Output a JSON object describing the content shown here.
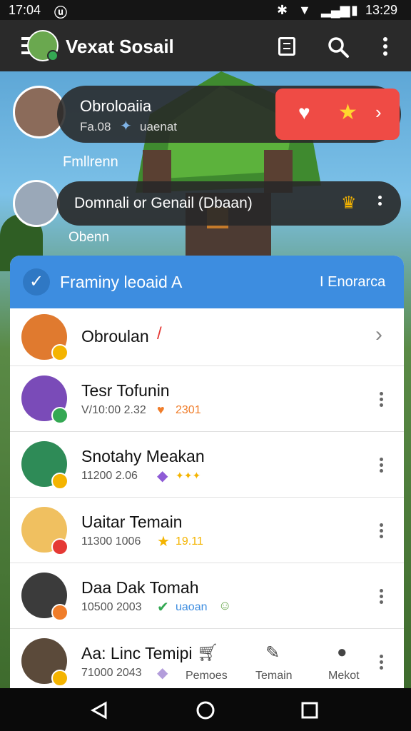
{
  "status_bar": {
    "time_left": "17:04",
    "time_right": "13:29"
  },
  "app_bar": {
    "title": "Vexat Sosail"
  },
  "floating": {
    "top_small": "",
    "bubble1": {
      "title": "Obroloaiia",
      "sub_a": "Fa.08",
      "sub_b": "uaenat"
    },
    "under1": "Fmllrenn",
    "bubble2": {
      "text": "Domnali or Genail (Dbaan)"
    },
    "under2": "Obenn"
  },
  "card": {
    "header_title": "Framiny leoaid A",
    "header_action": "I Enorarca",
    "rows": [
      {
        "name": "Obroulan",
        "sub_a": "",
        "sub_b": "",
        "avatar_color": "#e07a2f",
        "badge": "#f4b400"
      },
      {
        "name": "Tesr Tofunin",
        "sub_a": "V/10:00 2.32",
        "sub_b": "2301",
        "avatar_color": "#7a4bb8",
        "badge": "#34a853"
      },
      {
        "name": "Snotahy Meakan",
        "sub_a": "11200 2.06",
        "sub_b": "✦✦✦",
        "avatar_color": "#2e8b57",
        "badge": "#f4b400"
      },
      {
        "name": "Uaitar Temain",
        "sub_a": "11300 1006",
        "sub_b": "19.11",
        "avatar_color": "#f0c060",
        "badge": "#e53935"
      },
      {
        "name": "Daa Dak Tomah",
        "sub_a": "10500 2003",
        "sub_b": "uaoan",
        "avatar_color": "#3b3b3b",
        "badge": "#f07d2a"
      },
      {
        "name": "Aa: Linc Temipi",
        "sub_a": "71000 2043",
        "sub_b": "",
        "avatar_color": "#5b4a3a",
        "badge": "#f4b400"
      }
    ],
    "nav": {
      "item1": "Pemoes",
      "item2": "Temain",
      "item3": "Mekot"
    }
  },
  "colors": {
    "accent": "#3d8de0",
    "danger": "#ef4b45",
    "appbar": "#2a2a2a"
  },
  "icons": [
    "menu-icon",
    "document-icon",
    "search-icon",
    "more-vert-icon",
    "heart-icon",
    "star-icon",
    "chevron-right-icon",
    "crown-icon",
    "check-icon",
    "back-icon",
    "home-icon",
    "recents-icon"
  ]
}
